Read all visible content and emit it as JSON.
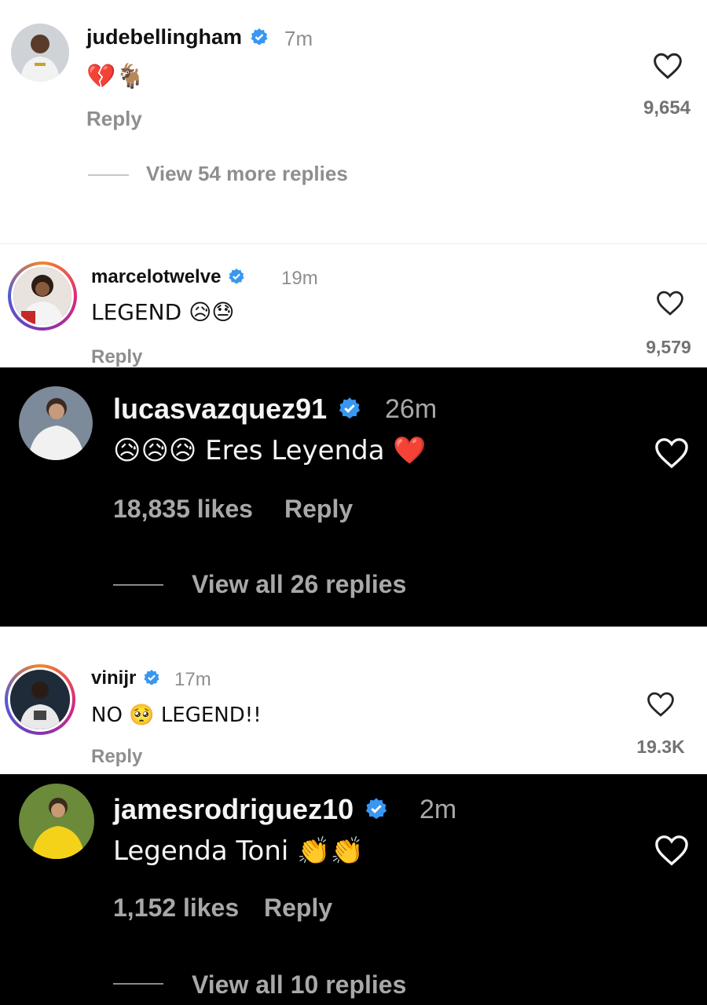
{
  "comments": [
    {
      "username": "judebellingham",
      "time": "7m",
      "text": "💔🐐",
      "reply_label": "Reply",
      "like_count": "9,654",
      "view_replies": "View 54 more replies"
    },
    {
      "username": "marcelotwelve",
      "time": "19m",
      "text": "LEGEND 😥😓",
      "reply_label": "Reply",
      "like_count": "9,579"
    },
    {
      "username": "lucasvazquez91",
      "time": "26m",
      "text": "😥😥😥 Eres Leyenda ❤️",
      "likes": "18,835 likes",
      "reply_label": "Reply",
      "view_replies": "View all 26 replies"
    },
    {
      "username": "vinijr",
      "time": "17m",
      "text": "NO 🥺 LEGEND!!",
      "reply_label": "Reply",
      "like_count": "19.3K"
    },
    {
      "username": "jamesrodriguez10",
      "time": "2m",
      "text": "Legenda Toni 👏👏",
      "likes": "1,152 likes",
      "reply_label": "Reply",
      "view_replies": "View all 10 replies"
    }
  ],
  "icons": {
    "verified": "verified-badge-icon",
    "heart": "heart-outline-icon"
  },
  "colors": {
    "verified_blue": "#3897f0",
    "light_secondary": "#8e8e8e",
    "dark_secondary": "#a8a8a8"
  }
}
